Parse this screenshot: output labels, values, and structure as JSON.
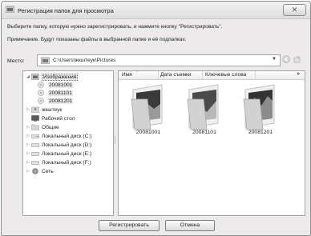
{
  "window": {
    "title": "Регистрация папок для просмотра",
    "close_glyph": "✕"
  },
  "instructions": {
    "line1": "Выберите папку, которую нужно зарегистрировать, и нажмите кнопку \"Регистрировать\".",
    "line2": "Примечание. Будут показаны файлы в выбранной папке и её подпапках."
  },
  "location": {
    "label": "Место:",
    "value": "C:\\Users\\жкштеук\\Pictures",
    "icon": "pictures-folder-icon"
  },
  "tree": {
    "items": [
      {
        "label": "Изображения",
        "icon": "pictures-folder-icon",
        "expanded": true,
        "selected": true
      },
      {
        "label": "20081001",
        "icon": "disc-icon"
      },
      {
        "label": "20081101",
        "icon": "disc-icon"
      },
      {
        "label": "20081201",
        "icon": "disc-icon"
      },
      {
        "label": "жкштеук",
        "icon": "user-folder-icon"
      },
      {
        "label": "Рабочий стол",
        "icon": "desktop-icon"
      },
      {
        "label": "Общие",
        "icon": "folder-icon"
      },
      {
        "label": "Локальный диск (C:)",
        "icon": "drive-icon"
      },
      {
        "label": "Локальный диск (D:)",
        "icon": "drive-icon"
      },
      {
        "label": "Локальный диск (E:)",
        "icon": "drive-icon"
      },
      {
        "label": "Локальный диск (F:)",
        "icon": "drive-icon"
      },
      {
        "label": "Сеть",
        "icon": "network-icon"
      }
    ]
  },
  "files": {
    "columns": [
      "Имя",
      "Дата съемки",
      "Ключевые слова"
    ],
    "more": "»",
    "folders": [
      {
        "name": "20081001"
      },
      {
        "name": "20081101"
      },
      {
        "name": "20081201"
      }
    ]
  },
  "buttons": {
    "register": "Регистрировать",
    "cancel": "Отмена"
  }
}
